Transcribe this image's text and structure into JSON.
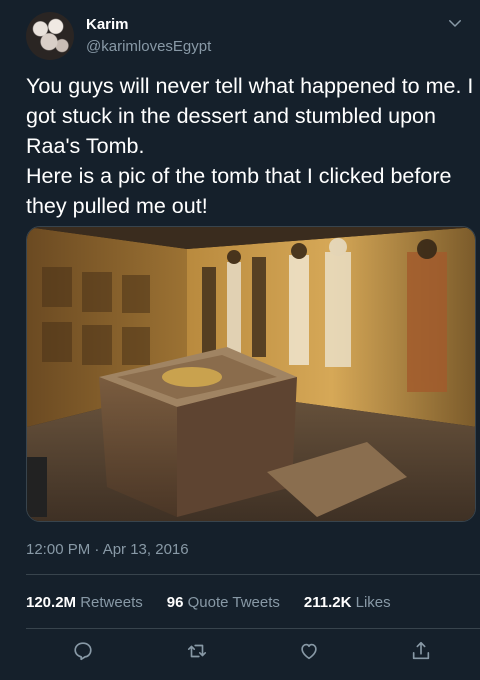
{
  "tweet": {
    "author_name": "Karim",
    "author_handle": "@karimlovesEgypt",
    "text": "You guys will never tell what happened to me. I got stuck in the dessert and stumbled upon Raa's Tomb.\nHere is a pic of the tomb that I clicked before they pulled me out!",
    "timestamp": "12:00 PM · Apr 13, 2016"
  },
  "stats": {
    "retweets_count": "120.2M",
    "retweets_label": "Retweets",
    "quotes_count": "96",
    "quotes_label": "Quote Tweets",
    "likes_count": "211.2K",
    "likes_label": "Likes"
  },
  "icons": {
    "more": "chevron-down-icon",
    "reply": "reply-icon",
    "retweet": "retweet-icon",
    "like": "heart-icon",
    "share": "share-icon"
  },
  "colors": {
    "background": "#15202b",
    "secondary_text": "#8899a6",
    "divider": "#38444d"
  }
}
